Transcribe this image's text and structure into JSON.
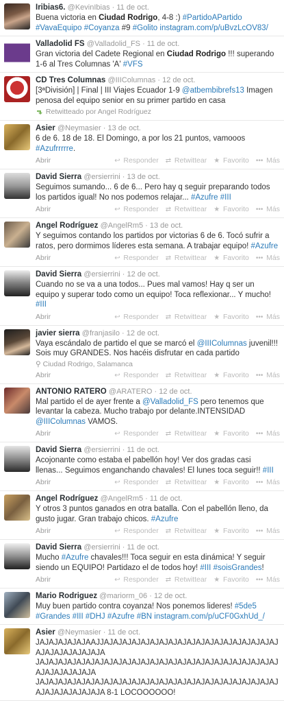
{
  "actions": {
    "open": "Abrir",
    "reply": "Responder",
    "retweet": "Retwittear",
    "favorite": "Favorito",
    "more": "Más"
  },
  "tweets": [
    {
      "name": "Iribias6.",
      "handle": "@KevinIbias",
      "date": "11 de oct.",
      "body": [
        [
          "t",
          "Buena victoria en "
        ],
        [
          "b",
          "Ciudad Rodrigo"
        ],
        [
          "t",
          ", 4-8 :) "
        ],
        [
          "a",
          "#PartidoAPartido"
        ],
        [
          "t",
          " "
        ],
        [
          "a",
          "#VavaEquipo"
        ],
        [
          "t",
          " "
        ],
        [
          "a",
          "#Coyanza"
        ],
        [
          "t",
          " #9 "
        ],
        [
          "a",
          "#Golito"
        ],
        [
          "t",
          " "
        ],
        [
          "a",
          "instagram.com/p/uBvzLcOV83/"
        ]
      ]
    },
    {
      "name": "Valladolid FS",
      "handle": "@Valladolid_FS",
      "date": "11 de oct.",
      "body": [
        [
          "t",
          "Gran victoria del Cadete Regional en "
        ],
        [
          "b",
          "Ciudad Rodrigo"
        ],
        [
          "t",
          " !!! superando 1-6 al Tres Columnas 'A' "
        ],
        [
          "a",
          "#VFS"
        ]
      ]
    },
    {
      "name": "CD Tres Columnas",
      "handle": "@IIIColumnas",
      "date": "12 de oct.",
      "body": [
        [
          "t",
          "[3ªDivisión] | Final | III Viajes Ecuador 1-9 "
        ],
        [
          "a",
          "@atbembibrefs13"
        ],
        [
          "t",
          " Imagen penosa del equipo senior en su primer partido en casa"
        ]
      ],
      "retweeted": "Retwitteado por Angel Rodríguez"
    },
    {
      "name": "Asier",
      "handle": "@Neymasier",
      "date": "13 de oct.",
      "body": [
        [
          "t",
          "6 de 6. 18 de 18. El Domingo, a por los 21 puntos, vamooos "
        ],
        [
          "a",
          "#Azufrrrrre"
        ],
        [
          "t",
          "."
        ]
      ],
      "actions": true
    },
    {
      "name": "David Sierra",
      "handle": "@ersierrini",
      "date": "13 de oct.",
      "body": [
        [
          "t",
          "Seguimos sumando... 6 de 6... Pero hay q seguir preparando todos los partidos igual! No nos podemos relajar... "
        ],
        [
          "a",
          "#Azufre"
        ],
        [
          "t",
          " "
        ],
        [
          "a",
          "#III"
        ]
      ],
      "actions": true
    },
    {
      "name": "Angel Rodríguez",
      "handle": "@AngelRm5",
      "date": "13 de oct.",
      "body": [
        [
          "t",
          "Y seguimos contando los partidos por victorias 6 de 6. Tocó sufrir a ratos, pero dormimos líderes esta semana. A trabajar equipo! "
        ],
        [
          "a",
          "#Azufre"
        ]
      ],
      "actions": true
    },
    {
      "name": "David Sierra",
      "handle": "@ersierrini",
      "date": "12 de oct.",
      "body": [
        [
          "t",
          "Cuando no se va a una todos... Pues mal vamos! Hay q ser un equipo y superar todo como un equipo! Toca reflexionar... Y mucho! "
        ],
        [
          "a",
          "#III"
        ]
      ],
      "actions": true
    },
    {
      "name": "javier sierra",
      "handle": "@franjasilo",
      "date": "12 de oct.",
      "body": [
        [
          "t",
          "Vaya escándalo de partido el que se marcó el "
        ],
        [
          "a",
          "@IIIColumnas"
        ],
        [
          "t",
          " juvenil!!! Sois muy GRANDES. Nos hacéis disfrutar en cada partido"
        ]
      ],
      "place": "Ciudad Rodrigo, Salamanca",
      "actions": true
    },
    {
      "name": "ANTONIO RATERO",
      "handle": "@ARATERO",
      "date": "12 de oct.",
      "body": [
        [
          "t",
          "Mal partido el de ayer frente a "
        ],
        [
          "a",
          "@Valladolid_FS"
        ],
        [
          "t",
          " pero tenemos que levantar la cabeza. Mucho trabajo por delante.INTENSIDAD "
        ],
        [
          "a",
          "@IIIColumnas"
        ],
        [
          "t",
          " VAMOS."
        ]
      ],
      "actions": true
    },
    {
      "name": "David Sierra",
      "handle": "@ersierrini",
      "date": "11 de oct.",
      "body": [
        [
          "t",
          "Acojonante como estaba el pabellón hoy! Ver dos gradas casi llenas... Seguimos enganchando chavales! El lunes toca seguir!! "
        ],
        [
          "a",
          "#III"
        ]
      ],
      "actions": true
    },
    {
      "name": "Angel Rodríguez",
      "handle": "@AngelRm5",
      "date": "11 de oct.",
      "body": [
        [
          "t",
          "Y otros 3 puntos ganados en otra batalla. Con el pabellón lleno, da gusto jugar. Gran trabajo chicos. "
        ],
        [
          "a",
          "#Azufre"
        ]
      ],
      "actions": true
    },
    {
      "name": "David Sierra",
      "handle": "@ersierrini",
      "date": "11 de oct.",
      "body": [
        [
          "t",
          "Mucho "
        ],
        [
          "a",
          "#Azufre"
        ],
        [
          "t",
          " chavales!!! Toca seguir en esta dinámica! Y seguir siendo un EQUIPO! Partidazo el de todos hoy! "
        ],
        [
          "a",
          "#III"
        ],
        [
          "t",
          " "
        ],
        [
          "a",
          "#soisGrandes"
        ],
        [
          "t",
          "!"
        ]
      ],
      "actions": true
    },
    {
      "name": "Mario Rodriguez",
      "handle": "@mariorm_06",
      "date": "12 de oct.",
      "body": [
        [
          "t",
          "Muy buen partido contra coyanza! Nos ponemos lideres! "
        ],
        [
          "a",
          "#5de5"
        ],
        [
          "t",
          " "
        ],
        [
          "a",
          "#Grandes"
        ],
        [
          "t",
          " "
        ],
        [
          "a",
          "#III"
        ],
        [
          "t",
          " "
        ],
        [
          "a",
          "#DHJ"
        ],
        [
          "t",
          " "
        ],
        [
          "a",
          "#Azufre"
        ],
        [
          "t",
          " "
        ],
        [
          "a",
          "#BN"
        ],
        [
          "t",
          " "
        ],
        [
          "a",
          "instagram.com/p/uCF0GxhUd_/"
        ]
      ]
    },
    {
      "name": "Asier",
      "handle": "@Neymasier",
      "date": "11 de oct.",
      "body": [
        [
          "t",
          "JAJAJAJAJAJAAJJAJAJAJAJAJAJAJAJAJAJAJAJAJAJAJAJAJAJAJAJAJAJAJAJAJAJA JAJAJAJAJAJAJAJAJAJAJAJAJAJAJAJAJAJAJAJAJAJAJAJAJAJAJAJAJAJAJAJAJA JAJAJAJAJAJAJAJAJAJAJAJAJAJAJAJAJAJAJAJAJAJAJAJAJAJAJAJAJAJAJAJAJAJA 8-1 LOCOOOOOO!"
        ]
      ]
    }
  ],
  "colors": {
    "link": "#2b7bb9",
    "meta": "#999999",
    "name": "#292f33"
  }
}
